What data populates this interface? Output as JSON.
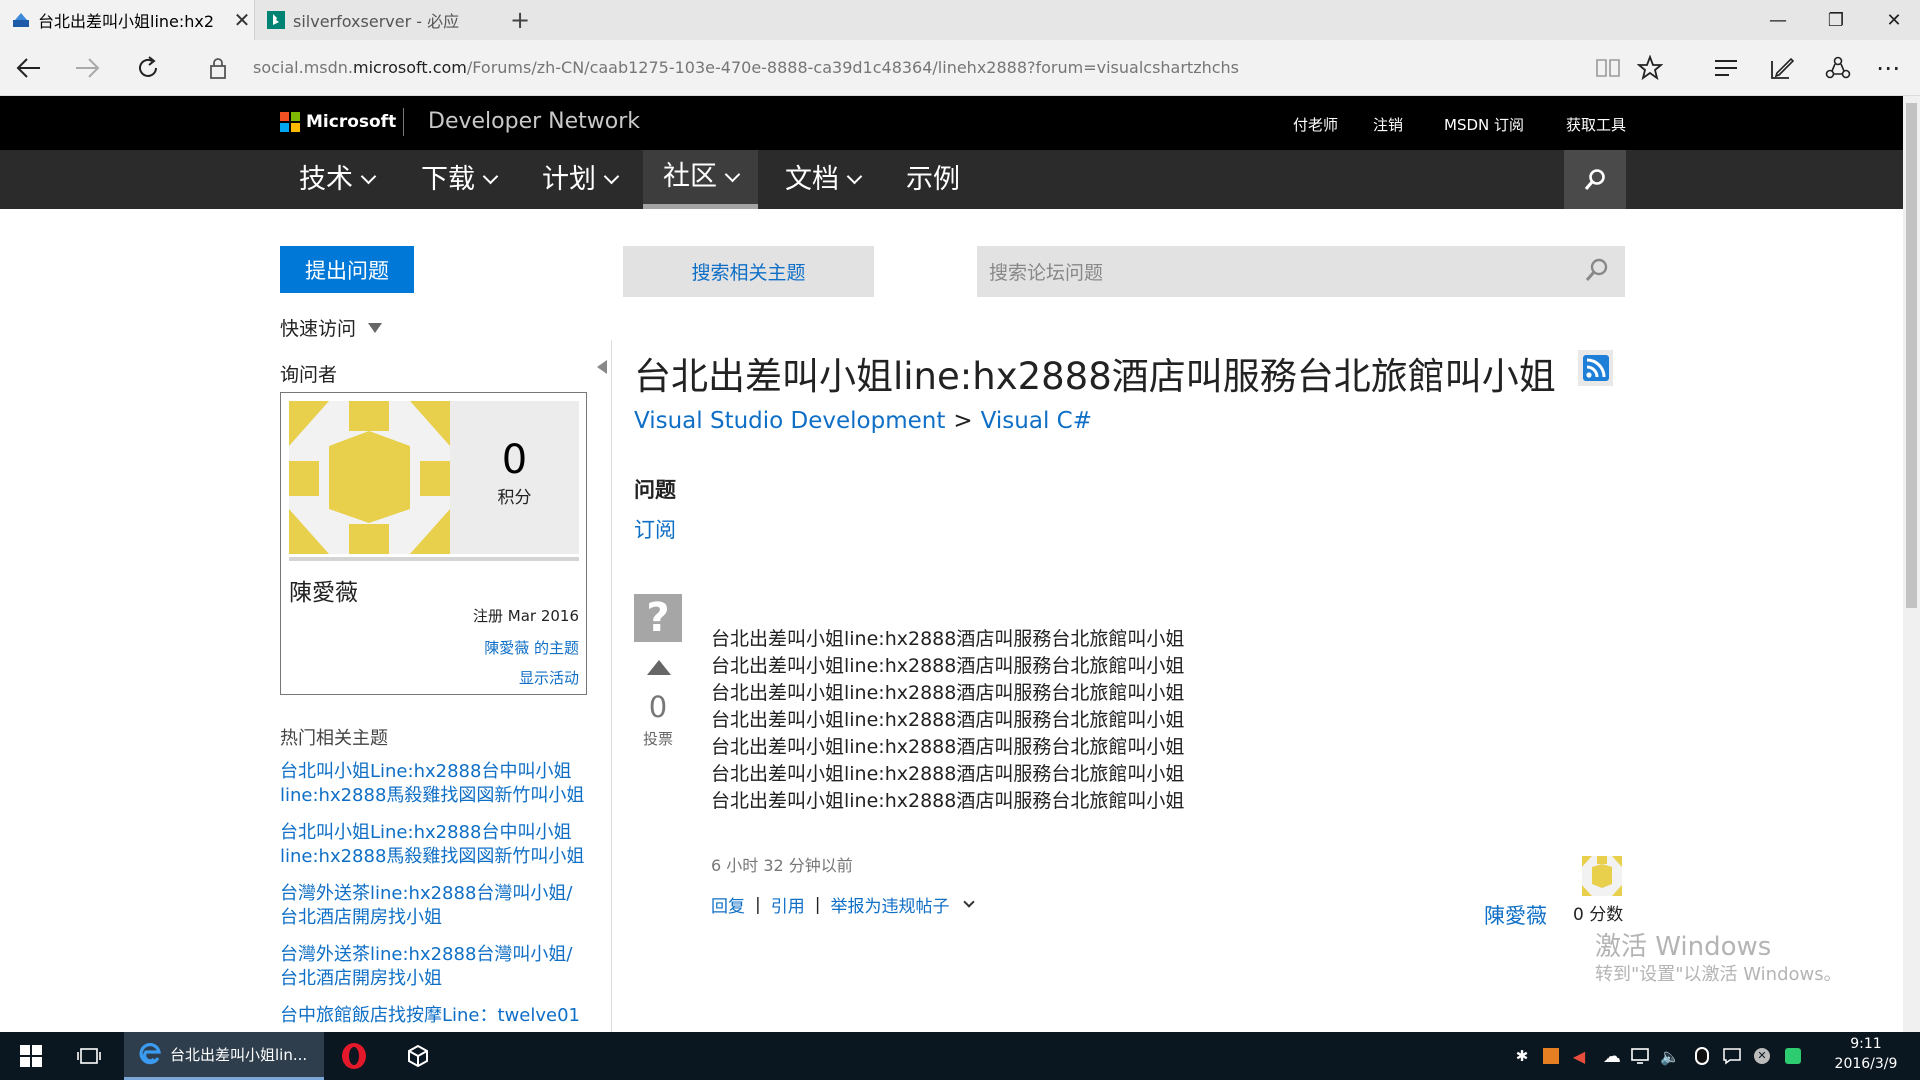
{
  "browser": {
    "tabs": [
      {
        "title": "台北出差叫小姐line:hx2",
        "icon": "msdn-tab-icon"
      },
      {
        "title": "silverfoxserver - 必应",
        "icon": "bing-tab-icon"
      }
    ],
    "url_prefix": "social.msdn.",
    "url_domain": "microsoft.com",
    "url_path": "/Forums/zh-CN/caab1275-103e-470e-8888-ca39d1c48364/linehx2888?forum=visualcshartzhchs"
  },
  "site": {
    "logo_text": "Microsoft",
    "title": "Developer Network",
    "top_links": [
      "付老师",
      "注销",
      "MSDN 订阅",
      "获取工具"
    ],
    "nav": [
      "技术",
      "下载",
      "计划",
      "社区",
      "文档",
      "示例"
    ]
  },
  "sidebar": {
    "ask_button": "提出问题",
    "quick_access": "快速访问",
    "asker_heading": "询问者",
    "points_value": "0",
    "points_label": "积分",
    "user_name": "陳愛薇",
    "joined": "注册 Mar 2016",
    "user_topics": "陳愛薇 的主题",
    "show_activity": "显示活动",
    "related_heading": "热门相关主题",
    "related": [
      "台北叫小姐Line:hx2888台中叫小姐line:hx2888馬殺雞找図図新竹叫小姐",
      "台北叫小姐Line:hx2888台中叫小姐line:hx2888馬殺雞找図図新竹叫小姐",
      "台灣外送茶line:hx2888台灣叫小姐/台北酒店開房找小姐",
      "台灣外送茶line:hx2888台灣叫小姐/台北酒店開房找小姐",
      "台中旅館飯店找按摩Line：twelve01"
    ]
  },
  "main": {
    "search_related": "搜索相关主题",
    "forum_search_placeholder": "搜索论坛问题",
    "question_title": "台北出差叫小姐line:hx2888酒店叫服務台北旅館叫小姐",
    "breadcrumb": [
      "Visual Studio Development",
      "Visual C#"
    ],
    "breadcrumb_sep": ">",
    "question_label": "问题",
    "subscribe": "订阅",
    "votes": "0",
    "votes_label": "投票",
    "body_lines": [
      "台北出差叫小姐line:hx2888酒店叫服務台北旅館叫小姐",
      "台北出差叫小姐line:hx2888酒店叫服務台北旅館叫小姐",
      "台北出差叫小姐line:hx2888酒店叫服務台北旅館叫小姐",
      "台北出差叫小姐line:hx2888酒店叫服務台北旅館叫小姐",
      "台北出差叫小姐line:hx2888酒店叫服務台北旅館叫小姐",
      "台北出差叫小姐line:hx2888酒店叫服務台北旅館叫小姐",
      "台北出差叫小姐line:hx2888酒店叫服務台北旅館叫小姐"
    ],
    "post_time": "6 小时 32 分钟以前",
    "actions": [
      "回复",
      "引用",
      "举报为违规帖子"
    ],
    "post_author": "陳愛薇",
    "post_score": "0 分数"
  },
  "watermark": {
    "line1": "激活 Windows",
    "line2": "转到\"设置\"以激活 Windows。"
  },
  "taskbar": {
    "active_app": "台北出差叫小姐lin...",
    "time": "9:11",
    "date": "2016/3/9"
  },
  "colors": {
    "link": "#0f6fc6",
    "ask_button": "#0078d7",
    "header_black": "#000000",
    "nav_dark": "#2b2b2b",
    "avatar_yellow": "#e8cf4c"
  }
}
